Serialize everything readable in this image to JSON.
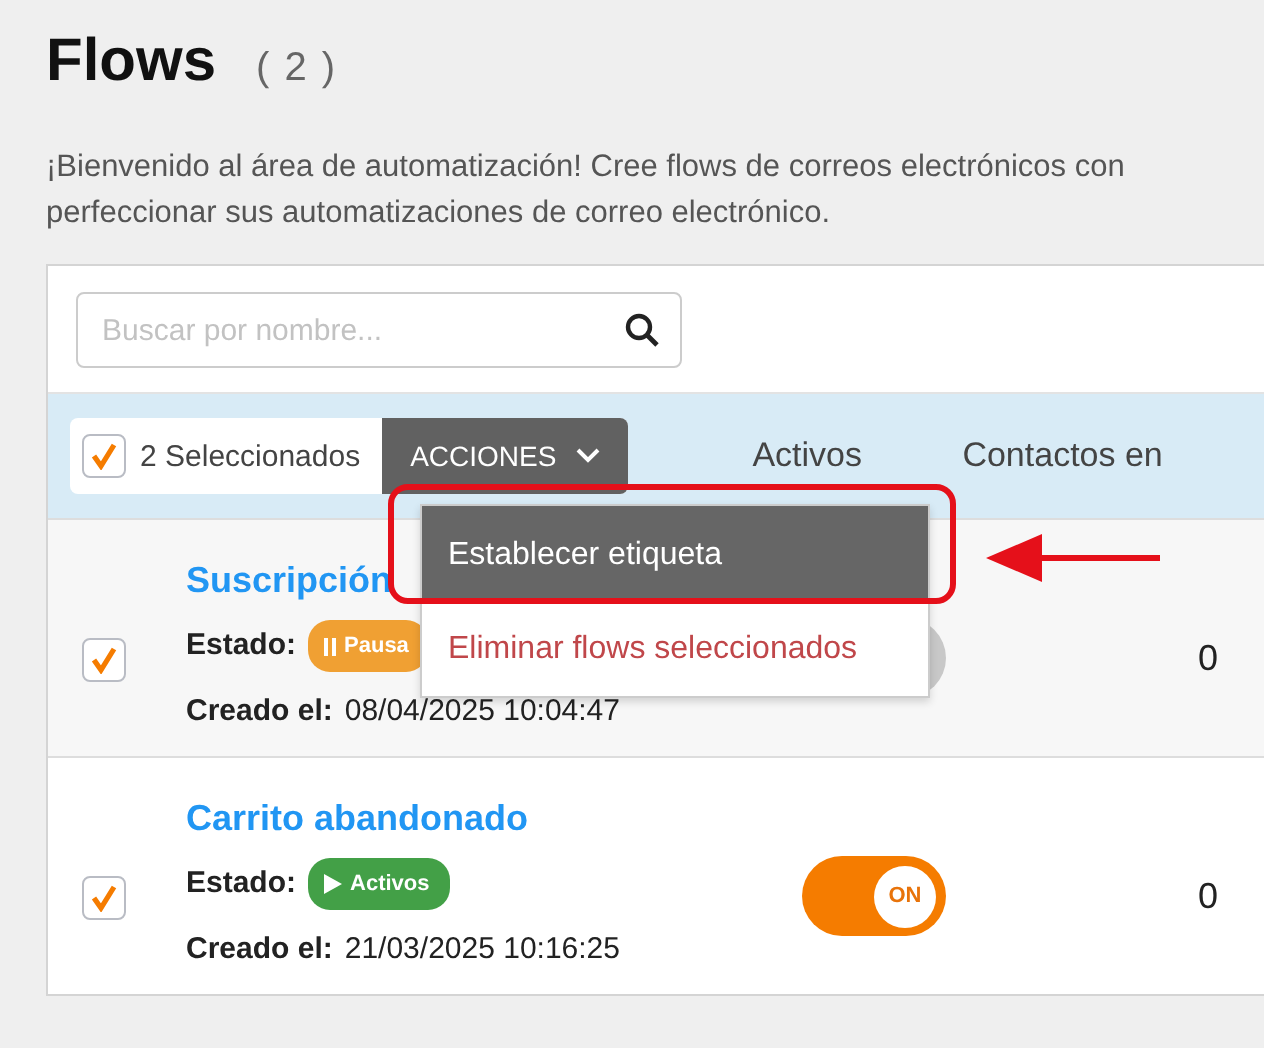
{
  "page": {
    "title": "Flows",
    "count": "( 2 )",
    "intro": "¡Bienvenido al área de automatización! Cree flows de correos electrónicos con\nperfeccionar sus automatizaciones de correo electrónico."
  },
  "search": {
    "placeholder": "Buscar por nombre..."
  },
  "toolbar": {
    "select_all_checked": true,
    "selected_label": "2 Seleccionados",
    "actions_label": "ACCIONES",
    "columns": [
      "Activos",
      "Contactos en"
    ]
  },
  "actions_menu": {
    "items": [
      {
        "label": "Establecer etiqueta",
        "kind": "normal",
        "selected": true
      },
      {
        "label": "Eliminar flows seleccionados",
        "kind": "danger",
        "selected": false
      }
    ]
  },
  "rows": [
    {
      "name": "Suscripción",
      "checked": true,
      "status_label": "Estado:",
      "status": {
        "text": "Pausa",
        "kind": "paused"
      },
      "created_label": "Creado el:",
      "created": "08/04/2025 10:04:47",
      "on": false,
      "count": "0"
    },
    {
      "name": "Carrito abandonado",
      "checked": true,
      "status_label": "Estado:",
      "status": {
        "text": "Activos",
        "kind": "active"
      },
      "created_label": "Creado el:",
      "created": "21/03/2025 10:16:25",
      "on": true,
      "toggle_label": "ON",
      "count": "0"
    }
  ]
}
